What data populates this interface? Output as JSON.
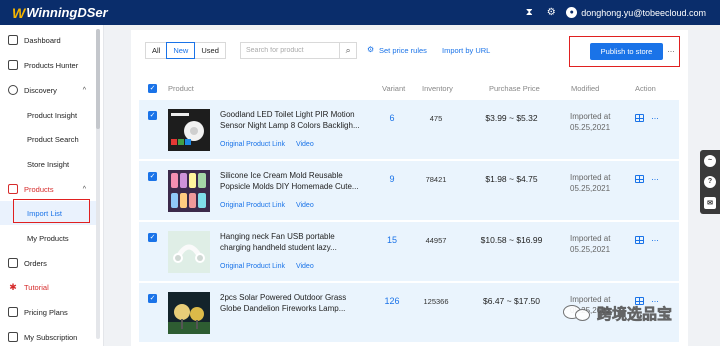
{
  "app": {
    "name": "WinningDSer"
  },
  "topbar": {
    "user_email": "donghong.yu@tobeecloud.com",
    "icons": [
      "hourglass-icon",
      "gear-icon",
      "user-icon"
    ]
  },
  "sidebar": {
    "items": [
      {
        "label": "Dashboard",
        "icon": "dashboard-icon"
      },
      {
        "label": "Products Hunter",
        "icon": "box-icon"
      },
      {
        "label": "Discovery",
        "icon": "compass-icon",
        "expanded": true
      },
      {
        "label": "Product Insight"
      },
      {
        "label": "Product Search"
      },
      {
        "label": "Store Insight"
      },
      {
        "label": "Products",
        "icon": "cube-icon",
        "expanded": true
      },
      {
        "label": "Import List",
        "active": true
      },
      {
        "label": "My Products"
      },
      {
        "label": "Orders",
        "icon": "orders-icon"
      },
      {
        "label": "Tutorial",
        "icon": "bulb-icon"
      },
      {
        "label": "Pricing Plans",
        "icon": "pricing-icon"
      },
      {
        "label": "My Subscription",
        "icon": "subscription-icon"
      }
    ]
  },
  "filters": {
    "all": "All",
    "new": "New",
    "used": "Used",
    "selected": "New"
  },
  "search": {
    "placeholder": "Search for product",
    "value": ""
  },
  "toolbar": {
    "set_price_rules": "Set price rules",
    "import_by_url": "Import by URL",
    "publish": "Publish to store",
    "more": "···"
  },
  "table": {
    "headers": {
      "product": "Product",
      "variant": "Variant",
      "inventory": "Inventory",
      "purchase_price": "Purchase Price",
      "modified": "Modified",
      "action": "Action"
    },
    "rows": [
      {
        "title": "Goodland LED Toilet Light PIR Motion Sensor Night Lamp 8 Colors Backligh...",
        "variant": "6",
        "inventory": "475",
        "price": "$3.99 ~ $5.32",
        "modified": "Imported at 05.25,2021",
        "link_original": "Original Product Link",
        "link_video": "Video",
        "checked": true
      },
      {
        "title": "Silicone Ice Cream Mold Reusable Popsicle Molds DIY Homemade Cute...",
        "variant": "9",
        "inventory": "78421",
        "price": "$1.98 ~ $4.75",
        "modified": "Imported at 05.25,2021",
        "link_original": "Original Product Link",
        "link_video": "Video",
        "checked": true
      },
      {
        "title": "Hanging neck Fan USB portable charging handheld student lazy...",
        "variant": "15",
        "inventory": "44957",
        "price": "$10.58 ~ $16.99",
        "modified": "Imported at 05.25,2021",
        "link_original": "Original Product Link",
        "link_video": "Video",
        "checked": true
      },
      {
        "title": "2pcs Solar Powered Outdoor Grass Globe Dandelion Fireworks Lamp...",
        "variant": "126",
        "inventory": "125366",
        "price": "$6.47 ~ $17.50",
        "modified": "Imported at 05.25,2021",
        "link_original": "Original Product Link",
        "link_video": "Video",
        "checked": true
      }
    ]
  },
  "floating_tools": [
    "messenger-icon",
    "help-icon",
    "mail-icon"
  ],
  "watermark": {
    "text": "跨境选品宝"
  },
  "colors": {
    "topbar": "#0a2d6b",
    "accent": "#1a73e8",
    "row_bg": "#eaf4fd",
    "highlight_box": "#e02020"
  }
}
